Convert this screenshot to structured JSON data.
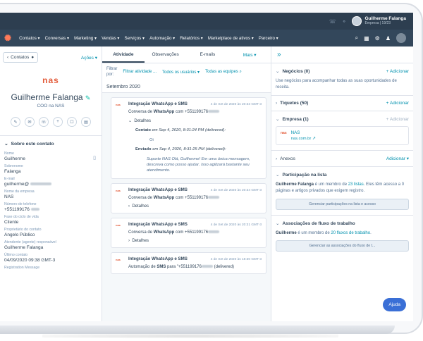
{
  "topbar": {
    "user_name": "Guilherme Falanga",
    "user_sub": "Empresa | 19/23"
  },
  "navbar": {
    "logo": "✺",
    "items": [
      "Contatos ▾",
      "Conversas ▾",
      "Marketing ▾",
      "Vendas ▾",
      "Serviços ▾",
      "Automação ▾",
      "Relatórios ▾",
      "Marketplace de ativos ▾",
      "Parceiro ▾"
    ]
  },
  "left": {
    "back_label": "Contatos",
    "actions_label": "Ações ▾",
    "company_logo_text": "nas",
    "contact_name": "Guilherme Falanga",
    "contact_title": "COO na NAS",
    "about_label": "Sobre este contato",
    "properties": [
      {
        "label": "Nome",
        "value": "Guilherme"
      },
      {
        "label": "Sobrenome",
        "value": "Falanga"
      },
      {
        "label": "E-mail",
        "value": "guilherme@"
      },
      {
        "label": "Nome da empresa",
        "value": "NAS"
      },
      {
        "label": "Número de telefone",
        "value": "+551199176"
      },
      {
        "label": "Fase do ciclo de vida",
        "value": "Cliente"
      },
      {
        "label": "Proprietário do contato",
        "value": "Angelo Público"
      },
      {
        "label": "Atendente (agente) responsável",
        "value": "Guilherme Falanga"
      },
      {
        "label": "Último contato",
        "value": "04/09/2020 09:38 GMT-3"
      },
      {
        "label": "Registration Message",
        "value": ""
      }
    ]
  },
  "center": {
    "tabs": [
      "Atividade",
      "Observações",
      "E-mails",
      "Mais ▾"
    ],
    "filter_label_1": "Filtrar",
    "filter_label_2": "por:",
    "filter_activity": "Filtrar atividade ...",
    "filter_users": "Todos os usuários ▾",
    "filter_teams": "Todas as equipes",
    "month": "Setembro 2020",
    "cards": [
      {
        "title": "Integração WhatsApp e SMS",
        "date": "4 de Set de 2020 às 20:33 GMT-3",
        "sub_pre": "Conversa de ",
        "sub_bold": "WhatsApp",
        "sub_post": " com +551199176",
        "details": "Detalhes",
        "contact_label": "Contato",
        "contact_when": "em Sep 4, 2020, 8:31:24 PM (delivered):",
        "contact_msg": "Oi",
        "sent_label": "Enviado",
        "sent_when": "em Sep 4, 2020, 8:31:25 PM (delivered):",
        "sent_msg": "Suporte NAS Olá, Guilherme! Em uma única mensagem, descreva como posso ajudar. Isso agilizará bastante seu atendimento."
      },
      {
        "title": "Integração WhatsApp e SMS",
        "date": "4 de Set de 2020 às 20:34 GMT-3",
        "sub_pre": "Conversa de ",
        "sub_bold": "WhatsApp",
        "sub_post": " com +551199176",
        "details": "Detalhes"
      },
      {
        "title": "Integração WhatsApp e SMS",
        "date": "4 de Set de 2020 às 20:31 GMT-3",
        "sub_pre": "Conversa de ",
        "sub_bold": "WhatsApp",
        "sub_post": " com +551199176",
        "details": "Detalhes"
      },
      {
        "title": "Integração WhatsApp e SMS",
        "date": "4 de Set de 2020 às 18:30 GMT-3",
        "sub_pre": "Automação de ",
        "sub_bold": "SMS",
        "sub_post": " para \"+551199176",
        "sub_tail": "(delivered)"
      }
    ]
  },
  "right": {
    "negocios": {
      "title": "Negócios (0)",
      "add": "+ Adicionar",
      "text": "Use negócios para acompanhar todas as suas oportunidades de receita."
    },
    "tiquetes": {
      "title": "Tíquetes (50)",
      "add": "+ Adicionar"
    },
    "empresa": {
      "title": "Empresa (1)",
      "add": "+ Adicionar",
      "company_logo": "nas",
      "company_name": "NAS",
      "company_domain": "nas.com.br ↗"
    },
    "anexos": {
      "title": "Anexos",
      "add": "Adicionar ▾"
    },
    "lista": {
      "title": "Participação na lista",
      "text_name": "Guilherme Falanga",
      "text_1": " é um membro de ",
      "text_link": "23 listas",
      "text_2": ". Eles têm acesso a 0 páginas e artigos privados que exigem registro.",
      "button": "Gerenciar participações na lista e acesso"
    },
    "fluxo": {
      "title": "Associações de fluxo de trabalho",
      "text_name": "Guilherme",
      "text_1": " é um membro de ",
      "text_link": "20 fluxos de trabalho",
      "text_2": ".",
      "button": "Gerenciar as associações do fluxo de t..."
    },
    "help": "Ajuda"
  }
}
